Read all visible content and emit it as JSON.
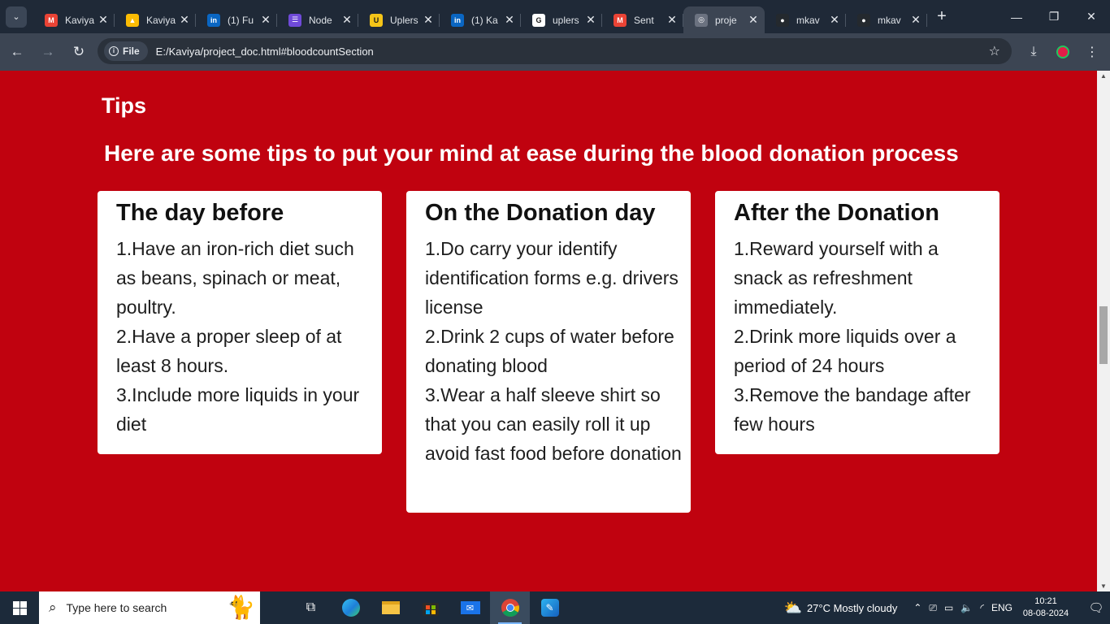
{
  "browser": {
    "tabs": [
      {
        "label": "Kaviya",
        "icon": "gmail-icon",
        "color": "#ea4335",
        "glyph": "M"
      },
      {
        "label": "Kaviya",
        "icon": "google-drive-icon",
        "color": "#fbbc04",
        "glyph": "▲"
      },
      {
        "label": "(1) Fu",
        "icon": "linkedin-icon",
        "color": "#0a66c2",
        "glyph": "in"
      },
      {
        "label": "Node",
        "icon": "node-doc-icon",
        "color": "#6f4ad8",
        "glyph": "☰"
      },
      {
        "label": "Uplers",
        "icon": "uplers-icon",
        "color": "#f5c518",
        "glyph": "U"
      },
      {
        "label": "(1) Ka",
        "icon": "linkedin-icon",
        "color": "#0a66c2",
        "glyph": "in"
      },
      {
        "label": "uplers",
        "icon": "google-icon",
        "color": "#ffffff",
        "glyph": "G"
      },
      {
        "label": "Sent",
        "icon": "gmail-icon",
        "color": "#ea4335",
        "glyph": "M"
      },
      {
        "label": "proje",
        "icon": "globe-icon",
        "color": "#6b7280",
        "glyph": "◎",
        "active": true
      },
      {
        "label": "mkav",
        "icon": "github-icon",
        "color": "#24292e",
        "glyph": "●"
      },
      {
        "label": "mkav",
        "icon": "github-icon",
        "color": "#24292e",
        "glyph": "●"
      }
    ],
    "address": {
      "chip_label": "File",
      "url": "E:/Kaviya/project_doc.html#bloodcountSection"
    }
  },
  "content": {
    "section_title": "Tips",
    "subtitle": "Here are some tips to put your mind at ease during the blood donation process",
    "cards": [
      {
        "title": "The day before",
        "lines": [
          "1.Have an iron-rich diet such as beans, spinach or meat, poultry.",
          "2.Have a proper sleep of at least 8 hours.",
          "3.Include more liquids in your diet"
        ]
      },
      {
        "title": "On the Donation day",
        "lines": [
          "1.Do carry your identify identification forms e.g. drivers license",
          "2.Drink 2 cups of water before donating blood",
          "3.Wear a half sleeve shirt so that you can easily roll it up avoid fast food before donation"
        ]
      },
      {
        "title": "After the Donation",
        "lines": [
          "1.Reward yourself with a snack as refreshment immediately.",
          "2.Drink more liquids over a period of 24 hours",
          "3.Remove the bandage after few hours"
        ]
      }
    ]
  },
  "taskbar": {
    "search_placeholder": "Type here to search",
    "weather": "27°C  Mostly cloudy",
    "language": "ENG",
    "time": "10:21",
    "date": "08-08-2024"
  },
  "colors": {
    "page_background": "#c0020f",
    "card_background": "#ffffff",
    "tabbar": "#1f2937",
    "toolbar": "#3c4553"
  }
}
